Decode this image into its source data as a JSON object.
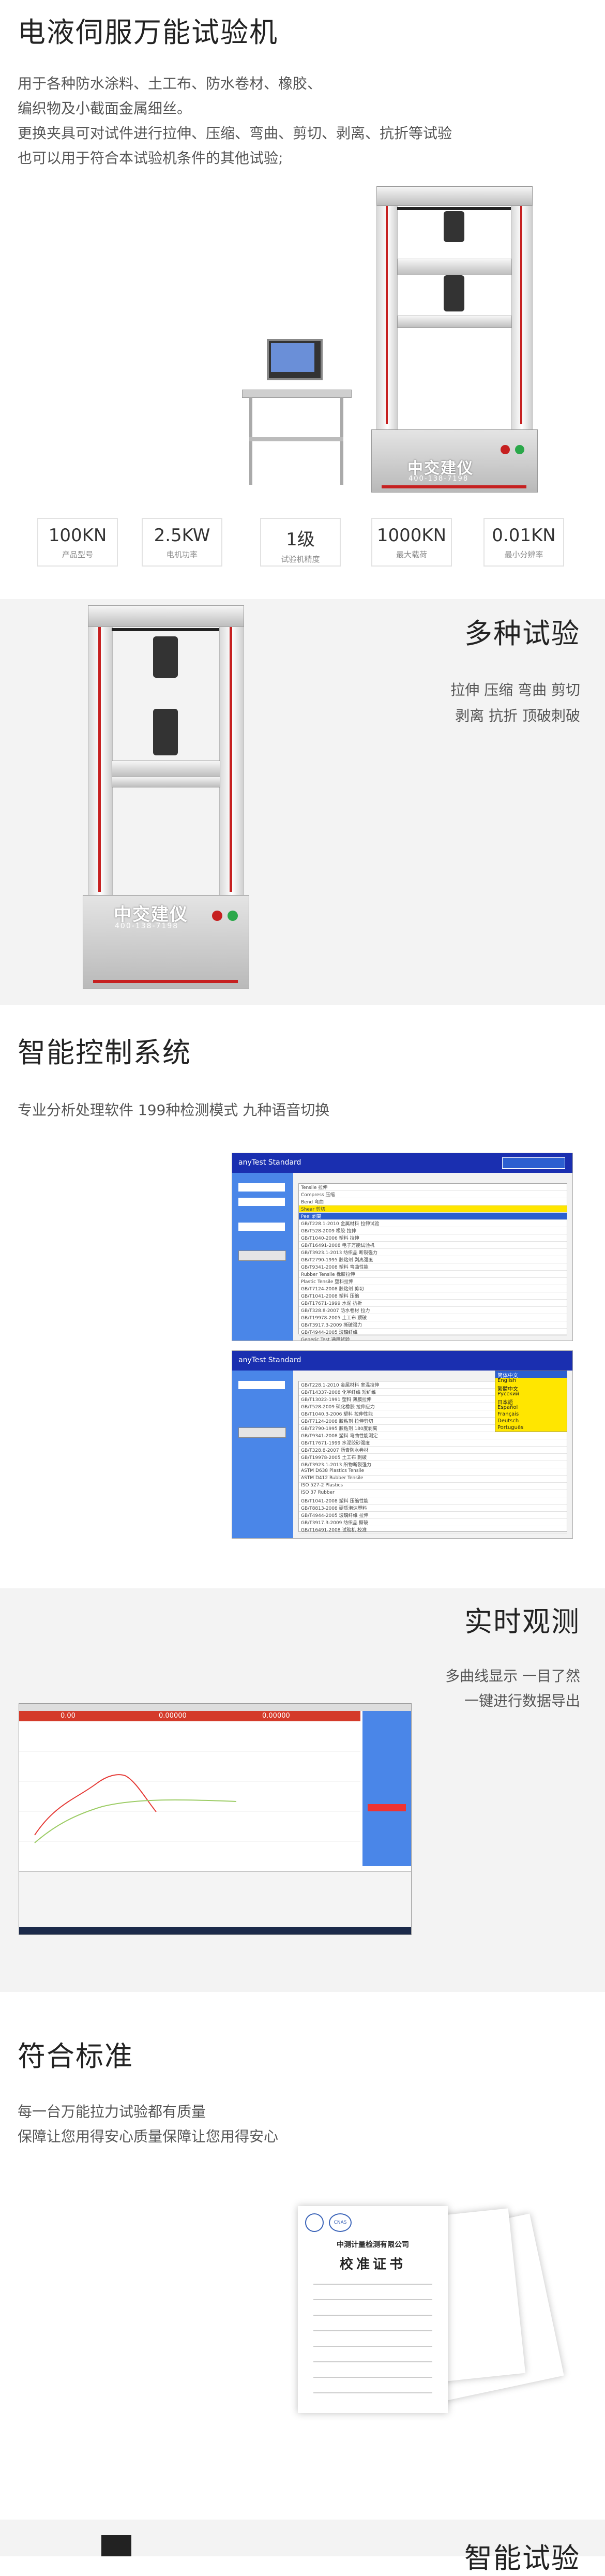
{
  "section1": {
    "title": "电液伺服万能试验机",
    "lines": [
      "用于各种防水涂料、土工布、防水卷材、橡胶、",
      "编织物及小截面金属细丝。",
      "更换夹具可对试件进行拉伸、压缩、弯曲、剪切、剥离、抗折等试验",
      "也可以用于符合本试验机条件的其他试验;"
    ],
    "brand": "中交建仪",
    "phone": "400-138-7198",
    "specs": [
      {
        "value": "100KN",
        "label": "产品型号"
      },
      {
        "value": "2.5KW",
        "label": "电机功率"
      },
      {
        "value": "1级",
        "label": "试验机精度"
      },
      {
        "value": "1000KN",
        "label": "最大载荷"
      },
      {
        "value": "0.01KN",
        "label": "最小分辨率"
      }
    ]
  },
  "section2": {
    "title": "多种试验",
    "line1": "拉伸 压缩 弯曲 剪切",
    "line2": "剥离 抗折 顶破刺破",
    "brand": "中交建仪",
    "phone": "400-138-7198"
  },
  "section3": {
    "title": "智能控制系统",
    "subtitle": "专业分析处理软件 199种检测模式 九种语音切换",
    "win_logo": "anyTest Standard",
    "win1_rows": [
      "Tensile 拉伸",
      "Compress 压缩",
      "Bend 弯曲",
      "Shear 剪切",
      "Peel 剥离",
      "GB/T228.1-2010 金属材料 拉伸试验",
      "GB/T528-2009 橡胶 拉伸",
      "GB/T1040-2006 塑料 拉伸",
      "GB/T16491-2008 电子万能试验机",
      "GB/T3923.1-2013 纺织品 断裂强力",
      "GB/T2790-1995 胶粘剂 剥离强度",
      "GB/T9341-2008 塑料 弯曲性能",
      "Rubber Tensile 橡胶拉伸",
      "Plastic Tensile 塑料拉伸",
      "GB/T7124-2008 胶粘剂 剪切",
      "GB/T1041-2008 塑料 压缩",
      "GB/T17671-1999 水泥 抗折",
      "GB/T328.8-2007 防水卷材 拉力",
      "GB/T19978-2005 土工布 顶破",
      "GB/T3917.3-2009 撕破强力",
      "GB/T4944-2005 玻璃纤维",
      "Generic Test 通用试验",
      "GB/T13022-1991 薄膜 拉伸"
    ],
    "win2_rows": [
      "GB/T228.1-2010 金属材料 室温拉伸",
      "GB/T14337-2008 化学纤维 短纤维",
      "GB/T13022-1991 塑料 薄膜拉伸",
      "GB/T528-2009 硫化橡胶 拉伸应力",
      "GB/T1040.3-2006 塑料 拉伸性能",
      "GB/T7124-2008 胶粘剂 拉伸剪切",
      "GB/T2790-1995 胶粘剂 180度剥离",
      "GB/T9341-2008 塑料 弯曲性能测定",
      "GB/T17671-1999 水泥胶砂强度",
      "GB/T328.8-2007 沥青防水卷材",
      "GB/T19978-2005 土工布 刺破",
      "GB/T3923.1-2013 织物断裂强力",
      "ASTM D638 Plastics Tensile",
      "ASTM D412 Rubber Tensile",
      "ISO 527-2 Plastics",
      "ISO 37 Rubber",
      "GB/T1041-2008 塑料 压缩性能",
      "GB/T8813-2008 硬质泡沫塑料",
      "GB/T4944-2005 玻璃纤维 拉伸",
      "GB/T3917.3-2009 纺织品 撕破",
      "GB/T16491-2008 试验机 校准"
    ],
    "lang_options": [
      "简体中文",
      "English",
      "繁體中文",
      "Русский",
      "日本語",
      "Español",
      "Français",
      "Deutsch",
      "Português"
    ]
  },
  "section4": {
    "title": "实时观测",
    "line1": "多曲线显示 一目了然",
    "line2": "一键进行数据导出",
    "readouts": [
      "0.00",
      "0.00000",
      "0.00000"
    ]
  },
  "section5": {
    "title": "符合标准",
    "line1": "每一台万能拉力试验都有质量",
    "line2": "保障让您用得安心质量保障让您用得安心",
    "cert_org": "中测计量检测有限公司",
    "cert_title": "校准证书",
    "cert_logo": "CNAS"
  },
  "section6": {
    "title": "智能试验"
  },
  "colors": {
    "accent": "#c62020",
    "window_bar": "#1a2fb0",
    "window_side": "#4a86e8",
    "band": "#f3f3f3"
  }
}
